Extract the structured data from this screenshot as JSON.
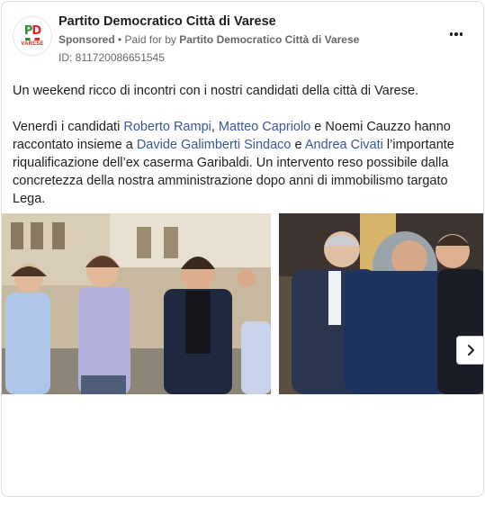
{
  "page": {
    "name": "Partito Democratico Città di Varese",
    "sponsored": "Sponsored",
    "separator": " • ",
    "paid_for_prefix": "Paid for by ",
    "paid_for_by": "Partito Democratico Città di Varese",
    "library_id": "ID: 811720086651545",
    "avatar_text": "VARESE",
    "avatar_mark": "PD"
  },
  "post": {
    "line1": "Un weekend ricco di incontri con i nostri candidati della città di Varese.",
    "p2_a": "Venerdì i candidati ",
    "link_1": "Roberto Rampi",
    "p2_b": ", ",
    "link_2": "Matteo Capriolo",
    "p2_c": " e Noemi Cauzzo hanno raccontato insieme a ",
    "link_3": "Davide Galimberti Sindaco",
    "p2_d": " e ",
    "link_4": "Andrea Civati",
    "p2_e": " l’importante riqualificazione dell’ex caserma Garibaldi. Un intervento reso possibile dalla concretezza della nostra amministrazione dopo anni di immobilismo targato Lega.",
    "ellipsis": "…"
  },
  "icons": {
    "more": "more-options-icon",
    "next": "chevron-right-icon"
  }
}
